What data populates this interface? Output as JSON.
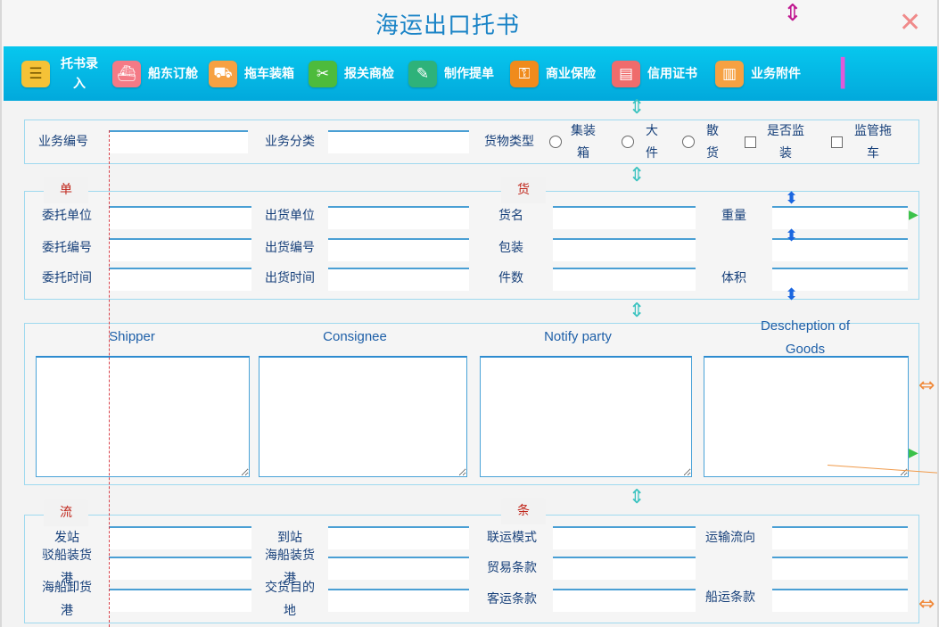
{
  "window": {
    "title": "海运出口托书",
    "close_glyph": "✕"
  },
  "toolbar": {
    "items": [
      {
        "label_line1": "托书录",
        "label_line2": "入",
        "icon": "document-icon",
        "glyph": "☰",
        "color": "#f5c237"
      },
      {
        "label": "船东订舱",
        "icon": "ship-icon",
        "glyph": "⛴",
        "color": "#f47a86"
      },
      {
        "label": "拖车装箱",
        "icon": "truck-icon",
        "glyph": "⛟",
        "color": "#f6a142"
      },
      {
        "label": "报关商检",
        "icon": "tools-icon",
        "glyph": "✂",
        "color": "#4dbb3c"
      },
      {
        "label": "制作提单",
        "icon": "edit-icon",
        "glyph": "✎",
        "color": "#2eb27a"
      },
      {
        "label": "商业保险",
        "icon": "lock-icon",
        "glyph": "⚿",
        "color": "#f08b1c"
      },
      {
        "label": "信用证书",
        "icon": "card-icon",
        "glyph": "▤",
        "color": "#ef6c6c"
      },
      {
        "label": "业务附件",
        "icon": "chart-icon",
        "glyph": "▥",
        "color": "#f6a142"
      }
    ]
  },
  "basic": {
    "business_no_label": "业务编号",
    "business_category_label": "业务分类",
    "cargo_type_label": "货物类型",
    "options": {
      "container": {
        "line1": "集装",
        "line2": "箱"
      },
      "bulk_large": {
        "line1": "大",
        "line2": "件"
      },
      "loose": {
        "line1": "散",
        "line2": "货"
      },
      "supervised": {
        "line1": "是否监",
        "line2": "装"
      },
      "supervised_truck": {
        "line1": "监管拖",
        "line2": "车"
      }
    }
  },
  "order": {
    "tab_left": "单",
    "tab_right": "货",
    "client_unit": "委托单位",
    "client_no": "委托编号",
    "client_time": "委托时间",
    "shipper_unit": "出货单位",
    "shipper_no": "出货编号",
    "shipper_time": "出货时间",
    "goods_name": "货名",
    "packing": "包装",
    "pieces": "件数",
    "weight": "重量",
    "volume": "体积"
  },
  "parties": {
    "shipper": "Shipper",
    "consignee": "Consignee",
    "notify": "Notify  party",
    "desc_line1": "Descheption  of",
    "desc_line2": "Goods"
  },
  "logistics": {
    "tab_left": "流",
    "tab_right": "条",
    "from_station": "发站",
    "barge_port_line1": "驳船装货",
    "barge_port_line2": "港",
    "ship_unload_line1": "海船卸货",
    "ship_unload_line2": "港",
    "to_station": "到站",
    "ship_load_line1": "海船装货",
    "ship_load_line2": "港",
    "delivery_line1": "交货目的",
    "delivery_line2": "地",
    "multimodal": "联运模式",
    "trade_terms": "贸易条款",
    "passenger_terms": "客运条款",
    "transport_flow": "运输流向",
    "shipping_terms": "船运条款"
  },
  "colors": {
    "accent": "#1b84c7",
    "toolbar": "#04b8e6",
    "tab_text": "#c0271c",
    "label": "#17407a"
  }
}
